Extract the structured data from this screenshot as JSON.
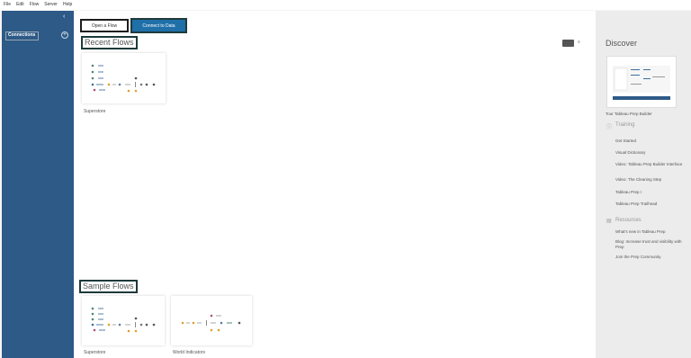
{
  "menu": [
    "File",
    "Edit",
    "Flow",
    "Server",
    "Help"
  ],
  "sidebar": {
    "collapse_icon": "chevron-left-icon",
    "connections_label": "Connections",
    "add_icon": "plus-circle-icon"
  },
  "toolbar": {
    "open_flow": "Open a Flow",
    "connect_to_data": "Connect to Data"
  },
  "recent": {
    "title": "Recent Flows",
    "view_list_label": "≡",
    "flows": [
      {
        "name": "Superstore"
      }
    ]
  },
  "samples": {
    "title": "Sample Flows",
    "flows": [
      {
        "name": "Superstore"
      },
      {
        "name": "World Indicators"
      }
    ]
  },
  "discover": {
    "title": "Discover",
    "tour": "Tour Tableau Prep Builder",
    "training_heading": "Training",
    "training_links": [
      "Get Started",
      "Visual Dictionary",
      "Video: Tableau Prep Builder Interface",
      "Video: The Cleaning Step",
      "Tableau Prep I",
      "Tableau Prep Trailhead"
    ],
    "resources_heading": "Resources",
    "resource_links": [
      "What's new in Tableau Prep",
      "Blog: Increase trust and visibility with Prep",
      "Join the Prep Community"
    ]
  },
  "colors": {
    "sidebar": "#2d5a87",
    "accent": "#1f6fa8",
    "panel": "#ececec"
  }
}
